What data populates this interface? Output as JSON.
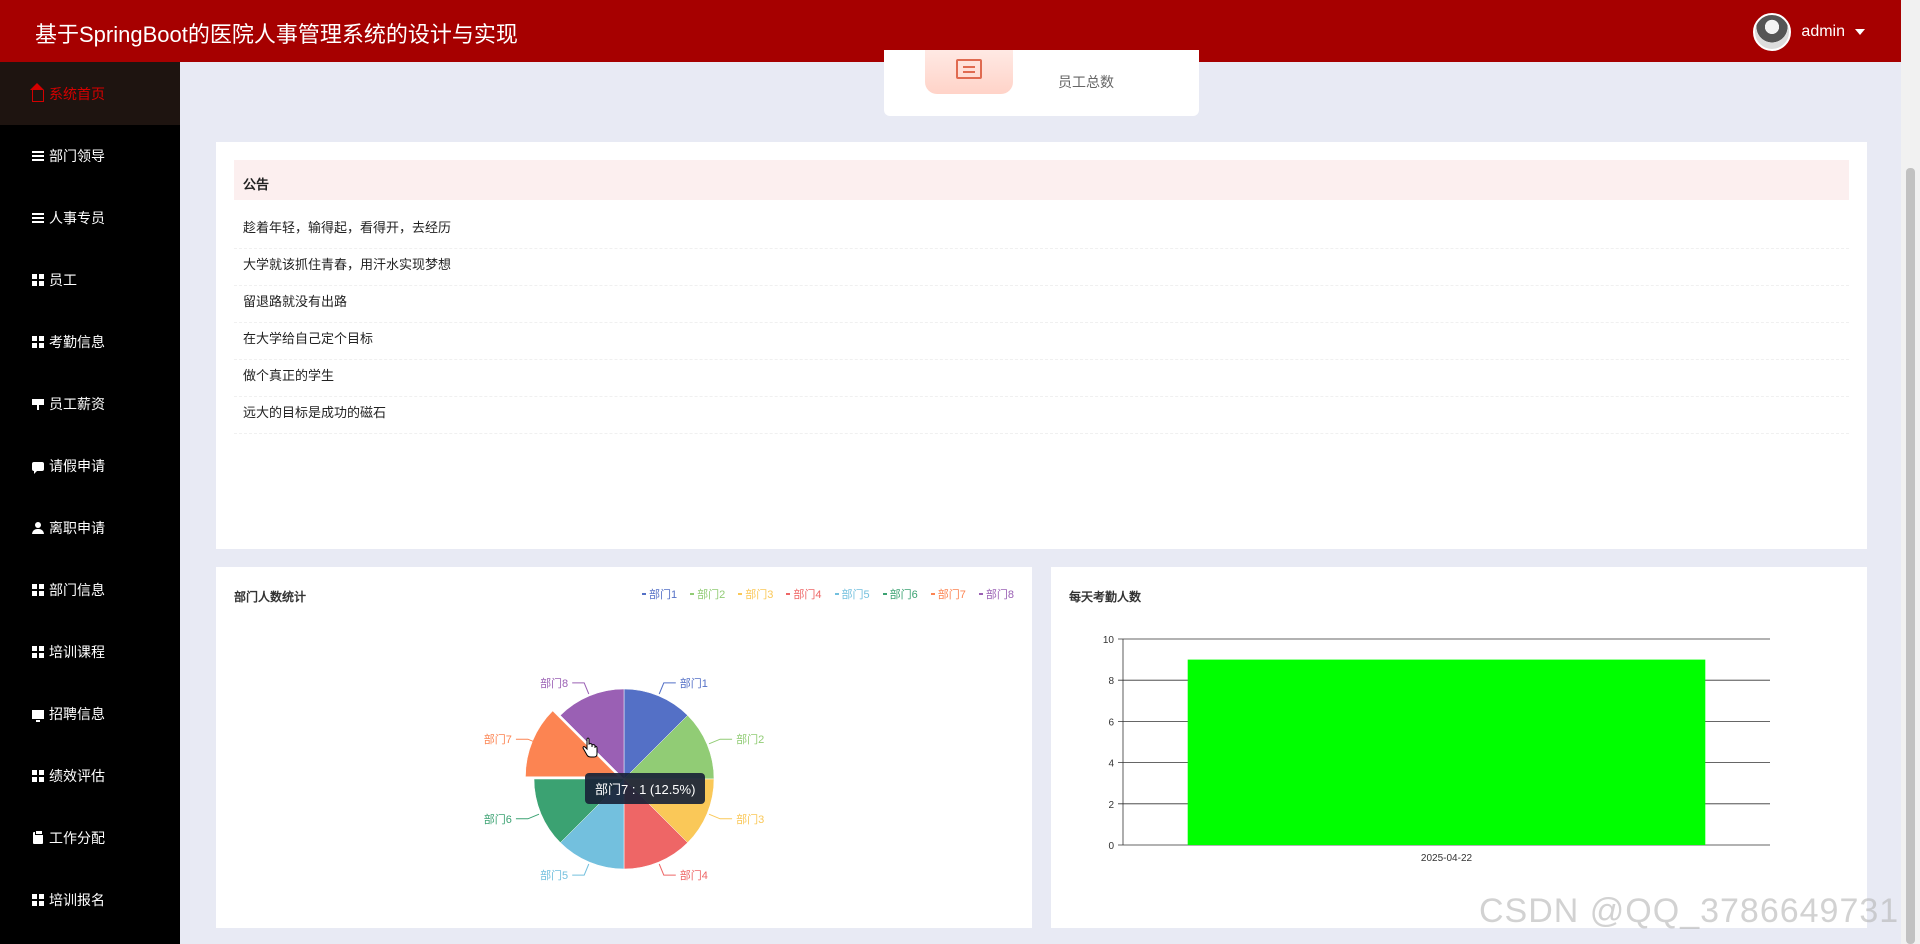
{
  "app": {
    "title": "基于SpringBoot的医院人事管理系统的设计与实现"
  },
  "user": {
    "name": "admin"
  },
  "sidebar": {
    "items": [
      {
        "label": "系统首页",
        "icon": "home-icon"
      },
      {
        "label": "部门领导",
        "icon": "list-icon"
      },
      {
        "label": "人事专员",
        "icon": "list-icon"
      },
      {
        "label": "员工",
        "icon": "grid-icon"
      },
      {
        "label": "考勤信息",
        "icon": "grid-icon"
      },
      {
        "label": "员工薪资",
        "icon": "stand-icon"
      },
      {
        "label": "请假申请",
        "icon": "chat-icon"
      },
      {
        "label": "离职申请",
        "icon": "person-icon"
      },
      {
        "label": "部门信息",
        "icon": "grid-icon"
      },
      {
        "label": "培训课程",
        "icon": "grid-icon"
      },
      {
        "label": "招聘信息",
        "icon": "monitor-icon"
      },
      {
        "label": "绩效评估",
        "icon": "grid-icon"
      },
      {
        "label": "工作分配",
        "icon": "clipboard-icon"
      },
      {
        "label": "培训报名",
        "icon": "grid-icon"
      }
    ]
  },
  "stat": {
    "label": "员工总数",
    "icon": "document-icon"
  },
  "notice": {
    "title": "公告",
    "items": [
      "趁着年轻，输得起，看得开，去经历",
      "大学就该抓住青春，用汗水实现梦想",
      "留退路就没有出路",
      "在大学给自己定个目标",
      "做个真正的学生",
      "远大的目标是成功的磁石"
    ]
  },
  "pie_panel": {
    "title": "部门人数统计",
    "tooltip": "部门7 : 1 (12.5%)"
  },
  "bar_panel": {
    "title": "每天考勤人数"
  },
  "chart_data": [
    {
      "type": "pie",
      "title": "部门人数统计",
      "categories": [
        "部门1",
        "部门2",
        "部门3",
        "部门4",
        "部门5",
        "部门6",
        "部门7",
        "部门8"
      ],
      "values": [
        1,
        1,
        1,
        1,
        1,
        1,
        1,
        1
      ],
      "colors": [
        "#5470c6",
        "#91cc75",
        "#fac858",
        "#ee6666",
        "#73c0de",
        "#3ba272",
        "#fc8452",
        "#9a60b4"
      ],
      "legend": "top-right",
      "highlighted": "部门7"
    },
    {
      "type": "bar",
      "title": "每天考勤人数",
      "categories": [
        "2025-04-22"
      ],
      "values": [
        9
      ],
      "ylim": [
        0,
        10
      ],
      "yticks": [
        0,
        2,
        4,
        6,
        8,
        10
      ],
      "grid": true,
      "color": "#00ff00"
    }
  ],
  "watermark": "CSDN @QQ_3786649731"
}
